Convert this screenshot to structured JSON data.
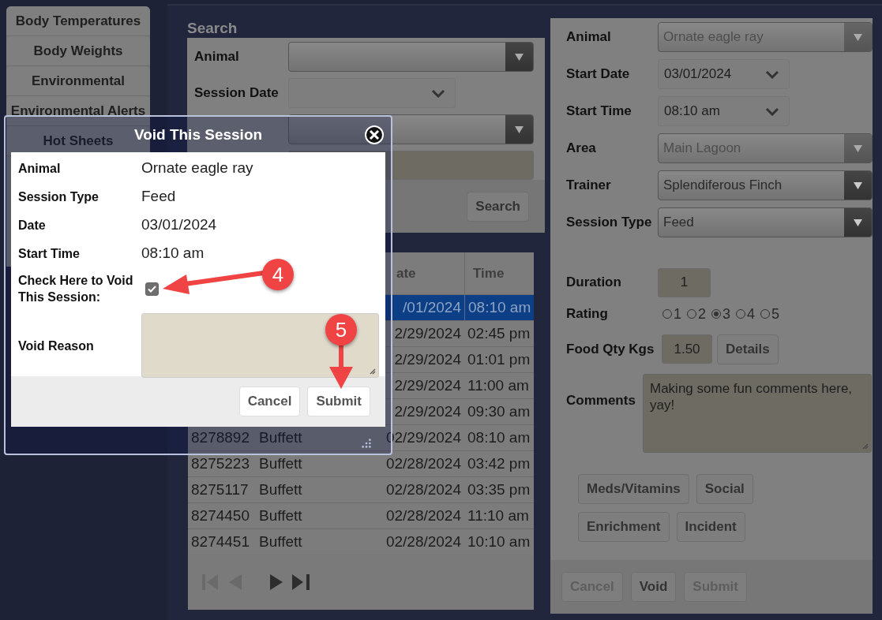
{
  "sidebar": {
    "items": [
      {
        "label": "Body Temperatures"
      },
      {
        "label": "Body Weights"
      },
      {
        "label": "Environmental"
      },
      {
        "label": "Environmental Alerts"
      },
      {
        "label": "Hot Sheets"
      }
    ]
  },
  "search": {
    "title": "Search",
    "fields": [
      {
        "kind": "select",
        "label": "Animal"
      },
      {
        "kind": "date",
        "label": "Session Date"
      },
      {
        "kind": "select"
      },
      {
        "kind": "text"
      }
    ],
    "button": "Search"
  },
  "table": {
    "columns": [
      "ate",
      "Time"
    ],
    "rows": [
      {
        "date": "/01/2024",
        "time": "08:10 am",
        "selected": true
      },
      {
        "date": "2/29/2024",
        "time": "02:45 pm",
        "selected": false
      },
      {
        "date": "2/29/2024",
        "time": "01:01 pm",
        "selected": false
      },
      {
        "date": "2/29/2024",
        "time": "11:00 am",
        "selected": false
      },
      {
        "date": "2/29/2024",
        "time": "09:30 am",
        "selected": false
      },
      {
        "id": "8278892",
        "name": "Buffett",
        "date": "02/29/2024",
        "time": "08:10 am",
        "selected": false
      },
      {
        "id": "8275223",
        "name": "Buffett",
        "date": "02/28/2024",
        "time": "03:42 pm",
        "selected": false
      },
      {
        "id": "8275117",
        "name": "Buffett",
        "date": "02/28/2024",
        "time": "03:35 pm",
        "selected": false
      },
      {
        "id": "8274450",
        "name": "Buffett",
        "date": "02/28/2024",
        "time": "11:10 am",
        "selected": false
      },
      {
        "id": "8274451",
        "name": "Buffett",
        "date": "02/28/2024",
        "time": "10:10 am",
        "selected": false
      }
    ]
  },
  "form": {
    "fields": [
      {
        "kind": "select",
        "label": "Animal",
        "value": "Ornate eagle ray",
        "disabled": true
      },
      {
        "kind": "date",
        "label": "Start Date",
        "value": "03/01/2024"
      },
      {
        "kind": "date",
        "label": "Start Time",
        "value": "08:10 am"
      },
      {
        "kind": "select",
        "label": "Area",
        "value": "Main Lagoon",
        "disabled": true
      },
      {
        "kind": "select",
        "label": "Trainer",
        "value": "Splendiferous Finch",
        "disabled": false
      },
      {
        "kind": "select",
        "label": "Session Type",
        "value": "Feed",
        "disabled": false
      },
      {
        "kind": "number",
        "label": "Duration",
        "value": "1"
      },
      {
        "kind": "rating",
        "label": "Rating",
        "options": [
          {
            "label": "1",
            "selected": false
          },
          {
            "label": "2",
            "selected": false
          },
          {
            "label": "3",
            "selected": true
          },
          {
            "label": "4",
            "selected": false
          },
          {
            "label": "5",
            "selected": false
          }
        ]
      },
      {
        "kind": "number",
        "label": "Food Qty Kgs",
        "value": "1.50",
        "button": "Details"
      },
      {
        "kind": "textarea",
        "label": "Comments",
        "value": "Making some fun comments here, yay!"
      }
    ],
    "extra_buttons": [
      "Meds/Vitamins",
      "Social",
      "Enrichment",
      "Incident"
    ],
    "footer_buttons": [
      {
        "label": "Cancel",
        "disabled": true
      },
      {
        "label": "Void",
        "disabled": false
      },
      {
        "label": "Submit",
        "disabled": true
      }
    ]
  },
  "dialog": {
    "title": "Void This Session",
    "rows": [
      {
        "label": "Animal",
        "value": "Ornate eagle ray"
      },
      {
        "label": "Session Type",
        "value": "Feed"
      },
      {
        "label": "Date",
        "value": "03/01/2024"
      },
      {
        "label": "Start Time",
        "value": "08:10 am"
      }
    ],
    "void_check": {
      "label": "Check Here to Void This Session:",
      "checked": true
    },
    "reason": {
      "label": "Void Reason"
    },
    "buttons": [
      "Cancel",
      "Submit"
    ]
  },
  "annotations": [
    {
      "number": "4"
    },
    {
      "number": "5"
    }
  ]
}
